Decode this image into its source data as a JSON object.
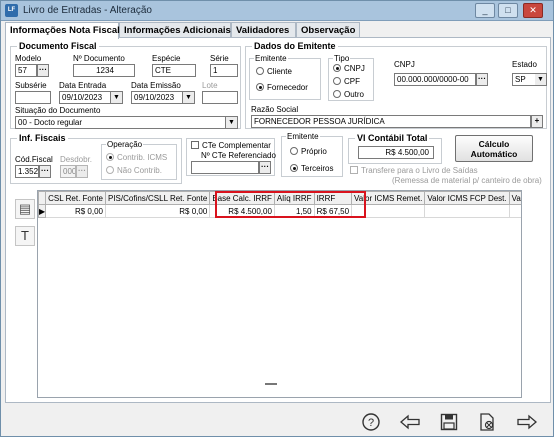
{
  "window": {
    "app_icon_text": "LF",
    "title": "Livro de Entradas - Alteração",
    "minimize": "_",
    "maximize": "□",
    "close": "✕"
  },
  "tabs": [
    {
      "label": "Informações Nota Fiscal",
      "active": true
    },
    {
      "label": "Informações Adicionais",
      "active": false
    },
    {
      "label": "Validadores",
      "active": false
    },
    {
      "label": "Observação",
      "active": false
    }
  ],
  "documento_fiscal": {
    "title": "Documento Fiscal",
    "modelo_label": "Modelo",
    "modelo_value": "57",
    "nro_doc_label": "Nº Documento",
    "nro_doc_value": "1234",
    "especie_label": "Espécie",
    "especie_value": "CTE",
    "serie_label": "Série",
    "serie_value": "1",
    "subserie_label": "Subsérie",
    "subserie_value": "",
    "data_entrada_label": "Data Entrada",
    "data_entrada_value": "09/10/2023",
    "data_emissao_label": "Data Emissão",
    "data_emissao_value": "09/10/2023",
    "lote_label": "Lote",
    "lote_value": "",
    "situacao_label": "Situação do Documento",
    "situacao_value": "00 - Docto regular"
  },
  "dados_emitente": {
    "title": "Dados do Emitente",
    "emitente_label": "Emitente",
    "opt_cliente": "Cliente",
    "opt_fornecedor": "Fornecedor",
    "tipo_label": "Tipo",
    "opt_cnpj": "CNPJ",
    "opt_cpf": "CPF",
    "opt_outro": "Outro",
    "cnpj_label": "CNPJ",
    "cnpj_value": "00.000.000/0000-00",
    "estado_label": "Estado",
    "estado_value": "SP",
    "razao_label": "Razão Social",
    "razao_value": "FORNECEDOR  PESSOA JURÍDICA"
  },
  "inf_fiscais": {
    "title": "Inf. Fiscais",
    "cod_fiscal_label": "Cód.Fiscal",
    "cod_fiscal_value": "1.352",
    "desdobr_label": "Desdobr.",
    "desdobr_value": "000",
    "operacao_label": "Operação",
    "opt_contrib": "Contrib. ICMS",
    "opt_nao_contrib": "Não Contrib."
  },
  "cte": {
    "complementar_label": "CTe Complementar",
    "referenciado_label": "Nº CTe Referenciado",
    "referenciado_value": ""
  },
  "emitente2": {
    "label": "Emitente",
    "opt_proprio": "Próprio",
    "opt_terceiros": "Terceiros"
  },
  "vl_contabil": {
    "label": "Vl Contábil Total",
    "value": "R$ 4.500,00"
  },
  "calculo_button": "Cálculo Automático",
  "transfere": {
    "label": "Transfere para o Livro de Saídas",
    "note": "(Remessa de material p/ canteiro de obra)"
  },
  "grid": {
    "columns": [
      "CSL Ret. Fonte",
      "PIS/Cofins/CSLL Ret. Fonte",
      "Base Calc. IRRF",
      "Alíq IRRF",
      "IRRF",
      "Valor ICMS Remet.",
      "Valor ICMS FCP Dest.",
      "Valor IC"
    ],
    "rows": [
      [
        "R$ 0,00",
        "R$ 0,00",
        "R$ 4.500,00",
        "1,50",
        "R$ 67,50",
        "",
        "",
        ""
      ]
    ]
  },
  "side_icons": [
    "document-icon",
    "text-icon"
  ],
  "side_icon_glyphs": [
    "▤",
    "T"
  ],
  "bottom_icons": {
    "help": "?",
    "back": "⇦",
    "save": "💾",
    "delete": "🗎",
    "next": "⇨"
  }
}
